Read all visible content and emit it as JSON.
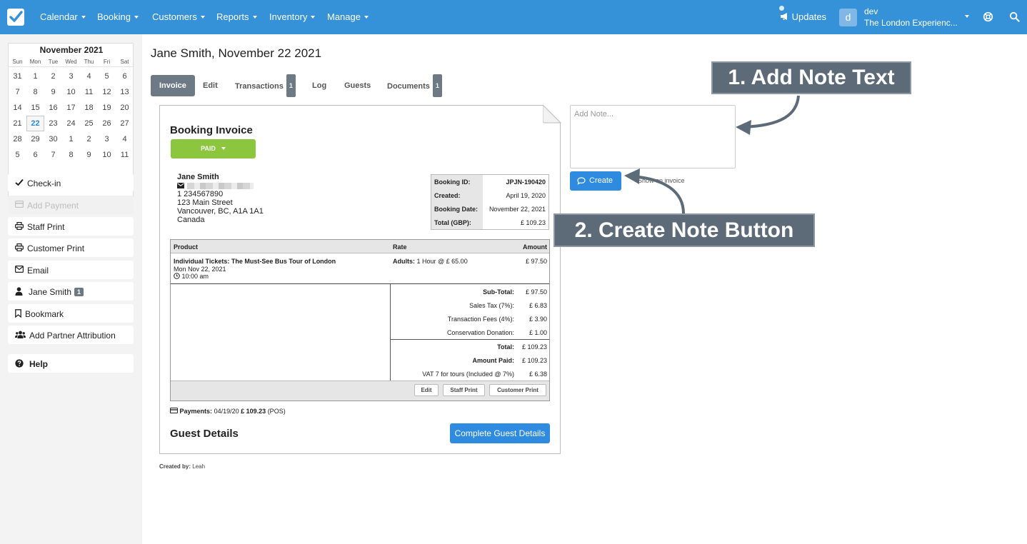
{
  "nav": {
    "items": [
      "Calendar",
      "Booking",
      "Customers",
      "Reports",
      "Inventory",
      "Manage"
    ],
    "updates": "Updates",
    "user_initial": "d",
    "user_name": "dev",
    "user_company": "The London Experienc...",
    "brand_color": "#3592d9"
  },
  "calendar": {
    "title": "November 2021",
    "dow": [
      "Sun",
      "Mon",
      "Tue",
      "Wed",
      "Thu",
      "Fri",
      "Sat"
    ],
    "weeks": [
      [
        "31",
        "1",
        "2",
        "3",
        "4",
        "5",
        "6"
      ],
      [
        "7",
        "8",
        "9",
        "10",
        "11",
        "12",
        "13"
      ],
      [
        "14",
        "15",
        "16",
        "17",
        "18",
        "19",
        "20"
      ],
      [
        "21",
        "22",
        "23",
        "24",
        "25",
        "26",
        "27"
      ],
      [
        "28",
        "29",
        "30",
        "1",
        "2",
        "3",
        "4"
      ],
      [
        "5",
        "6",
        "7",
        "8",
        "9",
        "10",
        "11"
      ]
    ],
    "selected": "22"
  },
  "sidebar": {
    "checkin": "Check-in",
    "add_payment": "Add Payment",
    "staff_print": "Staff Print",
    "customer_print": "Customer Print",
    "email": "Email",
    "customer": "Jane Smith",
    "customer_badge": "1",
    "bookmark": "Bookmark",
    "partner": "Add Partner Attribution",
    "help": "Help"
  },
  "page": {
    "title": "Jane Smith, November 22 2021",
    "tabs": [
      {
        "label": "Invoice",
        "badge": ""
      },
      {
        "label": "Edit",
        "badge": ""
      },
      {
        "label": "Transactions",
        "badge": "1"
      },
      {
        "label": "Log",
        "badge": ""
      },
      {
        "label": "Guests",
        "badge": ""
      },
      {
        "label": "Documents",
        "badge": "1"
      }
    ]
  },
  "invoice": {
    "title": "Booking Invoice",
    "status": "PAID",
    "customer": {
      "name": "Jane Smith",
      "phone": "1 234567890",
      "street": "123 Main Street",
      "city": "Vancouver, BC, A1A 1A1",
      "country": "Canada"
    },
    "booking": {
      "id_label": "Booking ID:",
      "id": "JPJN-190420",
      "created_label": "Created:",
      "created": "April 19, 2020",
      "date_label": "Booking Date:",
      "date": "November 22, 2021",
      "total_label": "Total (GBP):",
      "total": "£ 109.23"
    },
    "table": {
      "head_product": "Product",
      "head_rate": "Rate",
      "head_amount": "Amount",
      "product": "Individual Tickets: The Must-See Bus Tour of London",
      "product_date": "Mon Nov 22, 2021",
      "product_time": "10:00 am",
      "rate_label": "Adults:",
      "rate": "1 Hour @ £ 65.00",
      "amount": "£ 97.50"
    },
    "summary": {
      "subtotal_label": "Sub-Total:",
      "subtotal": "£ 97.50",
      "tax_label": "Sales Tax (7%):",
      "tax": "£ 6.83",
      "fees_label": "Transaction Fees (4%):",
      "fees": "£ 3.90",
      "donation_label": "Conservation Donation:",
      "donation": "£ 1.00",
      "total_label": "Total:",
      "total": "£ 109.23",
      "paid_label": "Amount Paid:",
      "paid": "£ 109.23",
      "vat_label": "VAT 7 for tours (Included @ 7%)",
      "vat": "£ 6.38"
    },
    "footer_buttons": {
      "edit": "Edit",
      "staff": "Staff Print",
      "customer": "Customer Print"
    },
    "payments_label": "Payments:",
    "payments_date": "04/19/20",
    "payments_amount": "£ 109.23",
    "payments_method": "(POS)",
    "guest_title": "Guest Details",
    "complete_guest": "Complete Guest Details",
    "created_by_label": "Created by:",
    "created_by": "Leah"
  },
  "note": {
    "placeholder": "Add Note...",
    "create": "Create",
    "show_on_invoice": "Show on invoice"
  },
  "callouts": {
    "one": "1. Add Note Text",
    "two": "2. Create Note Button"
  }
}
